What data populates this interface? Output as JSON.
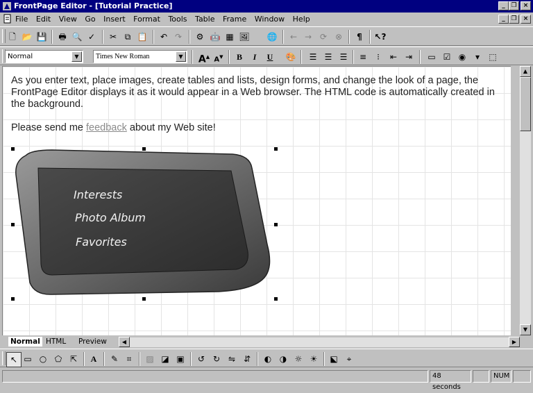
{
  "window": {
    "title": "FrontPage Editor - [Tutorial Practice]"
  },
  "menu": {
    "items": [
      "File",
      "Edit",
      "View",
      "Go",
      "Insert",
      "Format",
      "Tools",
      "Table",
      "Frame",
      "Window",
      "Help"
    ]
  },
  "format_bar": {
    "style": "Normal",
    "font": "Times New Roman"
  },
  "document": {
    "paragraph1": "As you enter text, place images, create tables and lists, design forms, and change the look of a page, the FrontPage Editor displays it as it would appear in a Web browser. The HTML code is automatically created in the background.",
    "paragraph2_before": "Please send me ",
    "link_text": "feedback",
    "paragraph2_after": " about my Web site!",
    "image": {
      "items": [
        "Interests",
        "Photo Album",
        "Favorites"
      ]
    }
  },
  "view_tabs": [
    "Normal",
    "HTML",
    "Preview"
  ],
  "status": {
    "time": "48 seconds",
    "num": "NUM"
  }
}
